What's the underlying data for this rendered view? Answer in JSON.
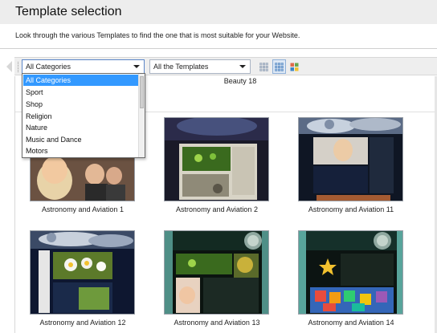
{
  "window": {
    "title": "Template selection",
    "description": "Look through the various Templates to find the one that is most suitable for your Website."
  },
  "toolbar": {
    "category_select": {
      "value": "All Categories"
    },
    "template_select": {
      "value": "All the Templates"
    },
    "views": [
      {
        "icon": "small-grid-icon",
        "active": false
      },
      {
        "icon": "medium-grid-icon",
        "active": true
      },
      {
        "icon": "color-grid-icon",
        "active": false
      }
    ]
  },
  "dropdown": {
    "options": [
      "All Categories",
      "Sport",
      "Shop",
      "Religion",
      "Nature",
      "Music and Dance",
      "Motors"
    ],
    "selected": "All Categories"
  },
  "templates": {
    "partial_row_label": "Beauty 18",
    "items": [
      {
        "name": "Astronomy and Aviation 1"
      },
      {
        "name": "Astronomy and Aviation 2"
      },
      {
        "name": "Astronomy and Aviation 11"
      },
      {
        "name": "Astronomy and Aviation 12"
      },
      {
        "name": "Astronomy and Aviation 13"
      },
      {
        "name": "Astronomy and Aviation 14"
      }
    ]
  },
  "colors": {
    "selection": "#3399ff",
    "toolbar_bg": "#eeeeee",
    "title_bg": "#ededed"
  }
}
